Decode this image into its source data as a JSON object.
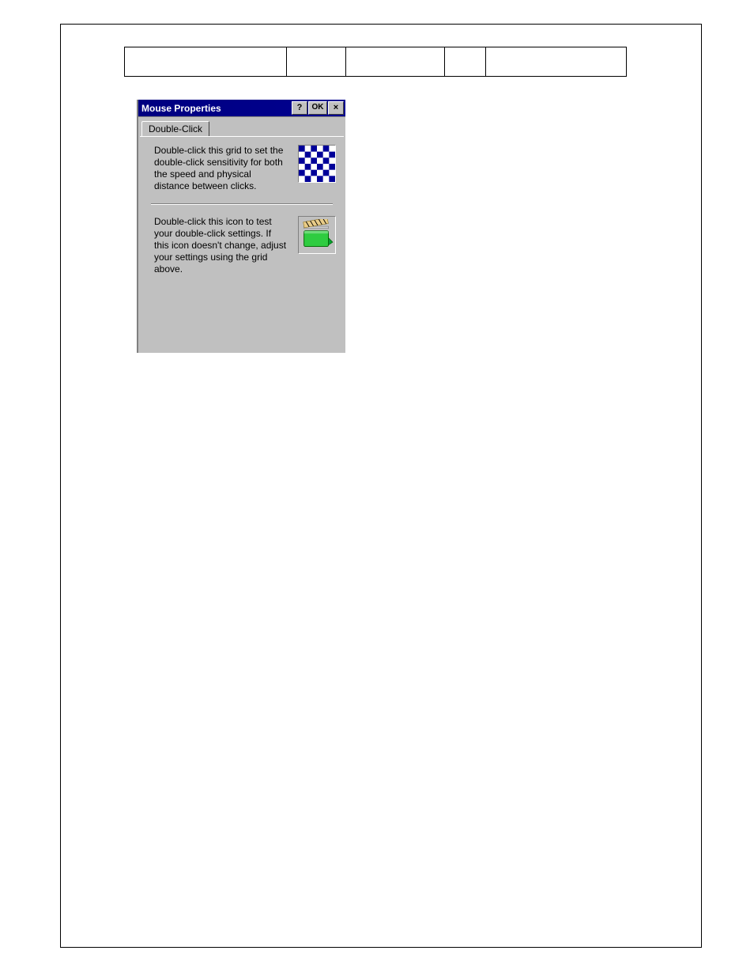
{
  "dialog": {
    "title": "Mouse Properties",
    "help": "?",
    "ok": "OK",
    "close": "×",
    "tab": "Double-Click",
    "section1_text": "Double-click this grid to set the double-click sensitivity for both the speed and physical distance between clicks.",
    "section2_text": "Double-click this icon to test your double-click settings. If this icon doesn't change, adjust your settings using the grid above."
  }
}
